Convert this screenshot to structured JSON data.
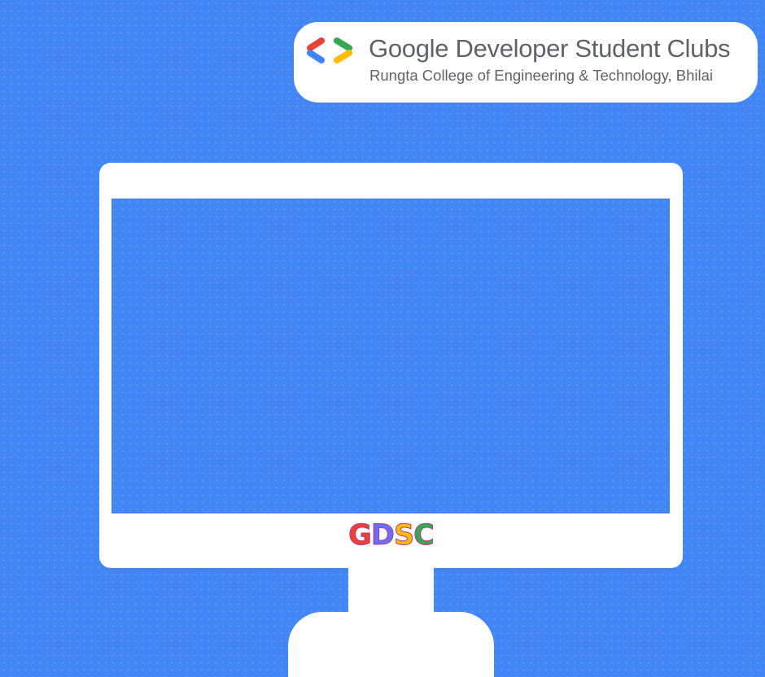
{
  "badge": {
    "title": "Google Developer Student Clubs",
    "subtitle": "Rungta College of Engineering & Technology, Bhilai",
    "logo_icon": "gdsc-brackets-logo-icon",
    "logo_colors": [
      "#4285f4",
      "#ea4335",
      "#34a853",
      "#fbbc04"
    ]
  },
  "monitor": {
    "brand_letters": [
      "G",
      "D",
      "S",
      "C"
    ],
    "brand_colors": [
      "#ea4335",
      "#6c6df5",
      "#fbbc04",
      "#34a853"
    ]
  },
  "colors": {
    "background": "#4285f4",
    "panel": "#ffffff",
    "text": "#5f6368"
  }
}
